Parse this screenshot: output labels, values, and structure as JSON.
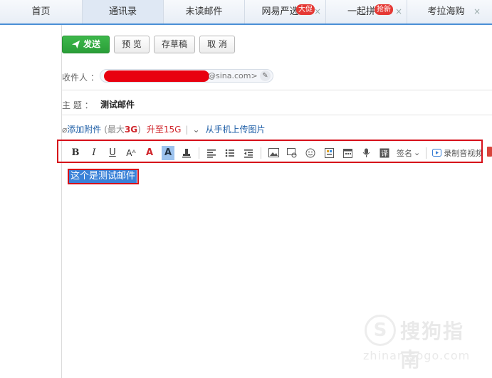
{
  "tabs": [
    {
      "label": "首页"
    },
    {
      "label": "通讯录"
    },
    {
      "label": "未读邮件"
    },
    {
      "label": "网易严选",
      "badge": "大促",
      "close": "×"
    },
    {
      "label": "一起拼",
      "badge": "抢新",
      "close": "×"
    },
    {
      "label": "考拉海购",
      "close": "×"
    }
  ],
  "actions": {
    "send": "发送",
    "preview": "预 览",
    "draft": "存草稿",
    "cancel": "取 消"
  },
  "recipient": {
    "label": "收件人 ：",
    "domain": "@sina.com>"
  },
  "subject": {
    "label": "主   题 ：",
    "value": "测试邮件"
  },
  "attach": {
    "add": "添加附件",
    "max_prefix": "(最大",
    "max_value": "3G",
    "max_suffix": ")",
    "upgrade": "升至15G",
    "mobile": "从手机上传图片"
  },
  "toolbar": {
    "bold": "B",
    "italic": "I",
    "underline": "U",
    "fontsize": "Aᴬ",
    "fontcolor": "A",
    "bgcolor": "A",
    "signature": "签名",
    "record": "录制音视频"
  },
  "body": {
    "text": "这个是测试邮件"
  },
  "watermark": {
    "title": "搜狗指南",
    "url": "zhinan.sogo.com"
  },
  "colors": {
    "send_green": "#2ea83c",
    "highlight_red": "#d6101a",
    "selection_blue": "#3b82d8",
    "link_blue": "#1f5fa7"
  }
}
